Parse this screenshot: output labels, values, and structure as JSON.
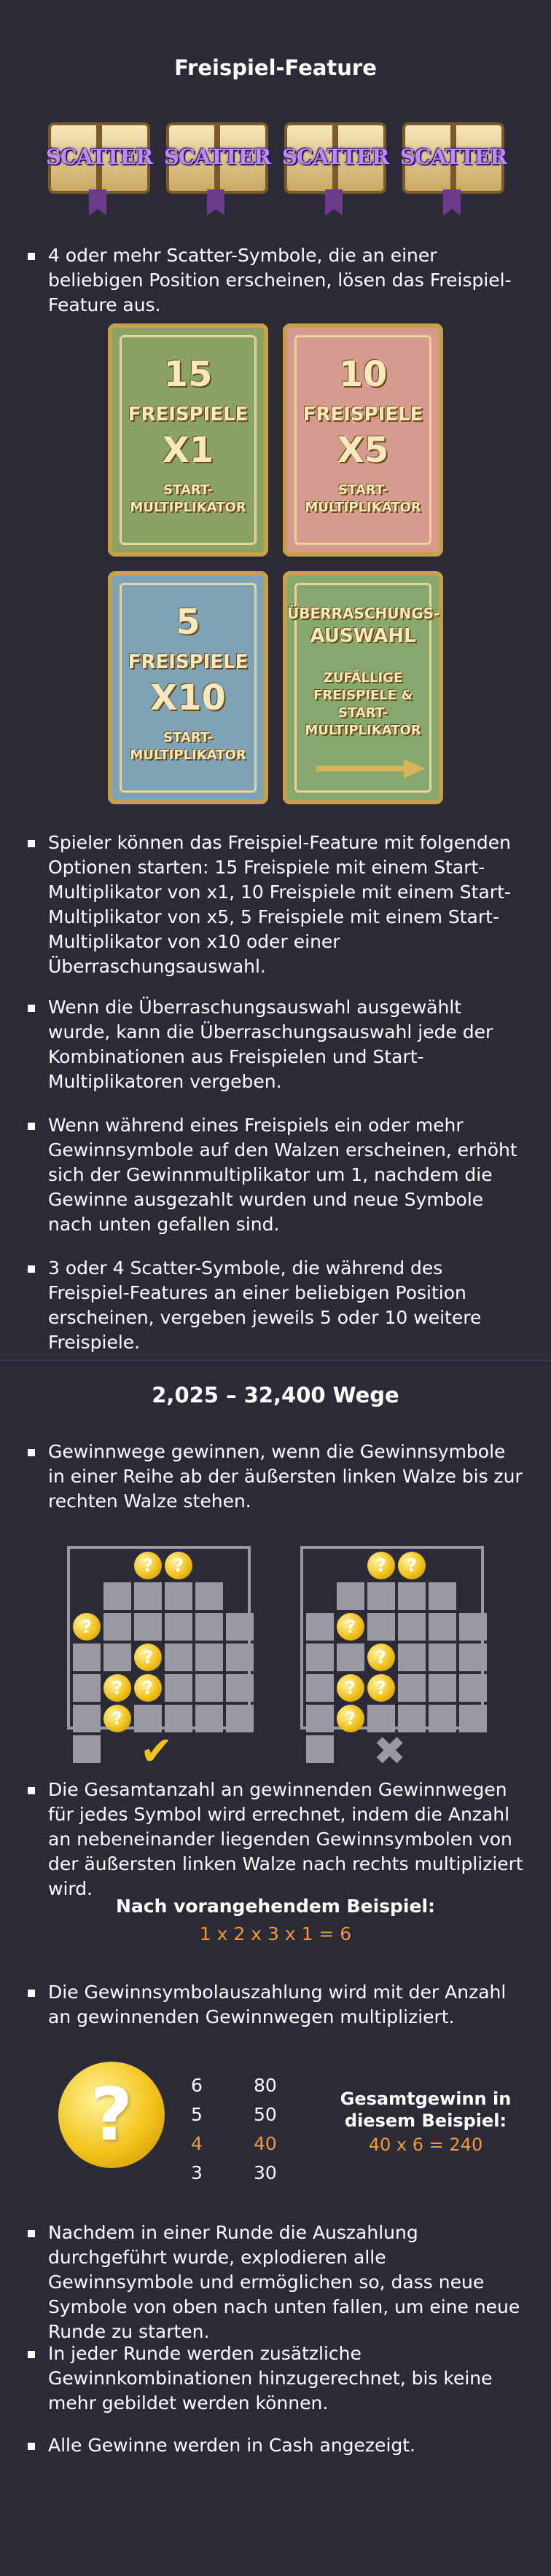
{
  "freispiel": {
    "title": "Freispiel-Feature",
    "scatter_label": "SCATTER",
    "bullet1": "4 oder mehr Scatter-Symbole, die an einer beliebigen Position erscheinen, lösen das Freispiel-Feature aus.",
    "tiles": [
      {
        "big": "15",
        "mid": "FREISPIELE",
        "mult": "X1",
        "line1": "START-",
        "line2": "MULTIPLIKATOR",
        "color": "#8aa364"
      },
      {
        "big": "10",
        "mid": "FREISPIELE",
        "mult": "X5",
        "line1": "START-",
        "line2": "MULTIPLIKATOR",
        "color": "#d79a8e"
      },
      {
        "big": "5",
        "mid": "FREISPIELE",
        "mult": "X10",
        "line1": "START-",
        "line2": "MULTIPLIKATOR",
        "color": "#7fa3b6"
      },
      {
        "title1": "ÜBERRASCHUNGS-",
        "title2": "AUSWAHL",
        "l1": "ZUFÄLLIGE",
        "l2": "FREISPIELE &",
        "l3": "START-",
        "l4": "MULTIPLIKATOR",
        "color": "#86a86e"
      }
    ],
    "bullet2": "Spieler können das Freispiel-Feature mit folgenden Optionen starten: 15 Freispiele mit einem Start-Multiplikator von x1, 10 Freispiele mit einem Start-Multiplikator von x5, 5 Freispiele mit einem Start-Multiplikator von x10 oder einer Überraschungsauswahl.",
    "bullet3": "Wenn die Überraschungsauswahl ausgewählt wurde, kann die Überraschungsauswahl jede der Kombinationen aus Freispielen und Start-Multiplikatoren vergeben.",
    "bullet4": "Wenn während eines Freispiels ein oder mehr Gewinnsymbole auf den Walzen erscheinen, erhöht sich der Gewinnmultiplikator um 1, nachdem die Gewinne ausgezahlt wurden und neue Symbole nach unten gefallen sind.",
    "bullet5": "3 oder 4 Scatter-Symbole, die während des Freispiel-Features an einer beliebigen Position erscheinen, vergeben jeweils 5 oder 10 weitere Freispiele."
  },
  "wege": {
    "title": "2,025 – 32,400 Wege",
    "bullet1": "Gewinnwege gewinnen, wenn die Gewinnsymbole in einer Reihe ab der äußersten linken Walze bis zur rechten Walze stehen.",
    "coin_glyph": "?",
    "check_mark": "✔",
    "cross_mark": "✖",
    "bullet2": "Die Gesamtanzahl an gewinnenden Gewinnwegen für jedes Symbol wird errechnet, indem die Anzahl an nebeneinander liegenden Gewinnsymbolen von der äußersten linken Walze nach rechts multipliziert wird.",
    "example_label": "Nach vorangehendem Beispiel:",
    "example_formula": "1 x 2 x 3 x 1 = 6",
    "bullet3": "Die Gewinnsymbolauszahlung wird mit der Anzahl an gewinnenden Gewinnwegen multipliziert.",
    "paytable": [
      {
        "n": "6",
        "v": "80",
        "hl": false
      },
      {
        "n": "5",
        "v": "50",
        "hl": false
      },
      {
        "n": "4",
        "v": "40",
        "hl": true
      },
      {
        "n": "3",
        "v": "30",
        "hl": false
      }
    ],
    "total_label_1": "Gesamtgewinn in",
    "total_label_2": "diesem Beispiel:",
    "total_formula": "40 x 6 = 240",
    "bullet4": "Nachdem in einer Runde die Auszahlung durchgeführt wurde, explodieren alle Gewinnsymbole und ermöglichen so, dass neue Symbole von oben nach unten fallen, um eine neue Runde zu starten.",
    "bullet5": "In jeder Runde werden zusätzliche Gewinnkombinationen hinzugerechnet, bis keine mehr gebildet werden können.",
    "bullet6": "Alle Gewinne werden in Cash angezeigt."
  },
  "colors": {
    "background": "#2b2b38",
    "accent_orange": "#f29a2e",
    "reel_cell": "#9a9aa6",
    "check": "#f1c21b",
    "cross": "#9a9aa6"
  }
}
